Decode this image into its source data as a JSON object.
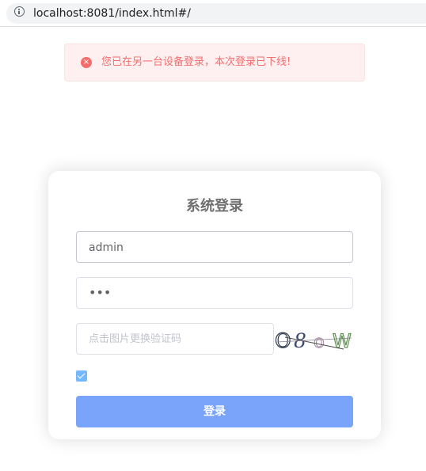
{
  "browser": {
    "url": "localhost:8081/index.html#/",
    "info_icon": "info-icon"
  },
  "alert": {
    "message": "您已在另一台设备登录，本次登录已下线!",
    "icon": "error-circle-icon",
    "icon_glyph": "×",
    "color": "#f56c6c"
  },
  "login": {
    "title": "系统登录",
    "username_value": "admin",
    "password_value": "•••",
    "captcha_placeholder": "点击图片更换验证码",
    "captcha_text": "O8oW",
    "remember_checked": true,
    "submit_label": "登录",
    "accent_color": "#79a4f9"
  }
}
